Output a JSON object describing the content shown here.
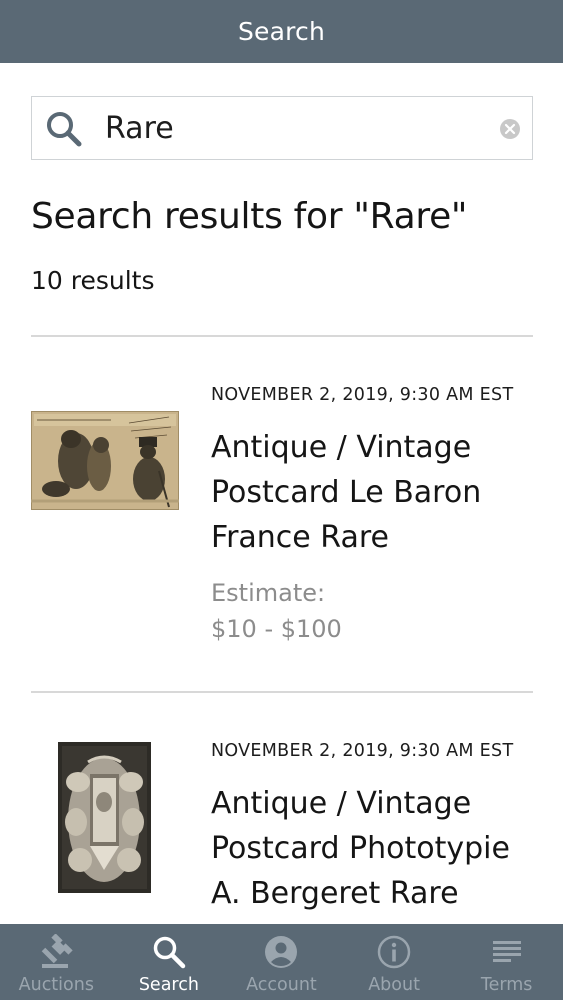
{
  "header": {
    "title": "Search"
  },
  "search": {
    "value": "Rare"
  },
  "results_heading": "Search results for \"Rare\"",
  "results_count": "10 results",
  "results": [
    {
      "date": "NOVEMBER 2, 2019, 9:30 AM EST",
      "title": "Antique / Vintage Postcard Le Baron France Rare",
      "estimate_label": "Estimate:",
      "estimate_range": "$10 - $100"
    },
    {
      "date": "NOVEMBER 2, 2019, 9:30 AM EST",
      "title": "Antique / Vintage Postcard Phototypie A. Bergeret Rare"
    }
  ],
  "tabbar": {
    "items": [
      {
        "label": "Auctions",
        "icon": "gavel-icon"
      },
      {
        "label": "Search",
        "icon": "search-icon"
      },
      {
        "label": "Account",
        "icon": "account-icon"
      },
      {
        "label": "About",
        "icon": "info-icon"
      },
      {
        "label": "Terms",
        "icon": "list-icon"
      }
    ],
    "active": "Search"
  },
  "colors": {
    "header_bg": "#5a6975",
    "tab_inactive": "#9aa5ae",
    "tab_active": "#ffffff",
    "estimate_text": "#8c8c8c"
  }
}
